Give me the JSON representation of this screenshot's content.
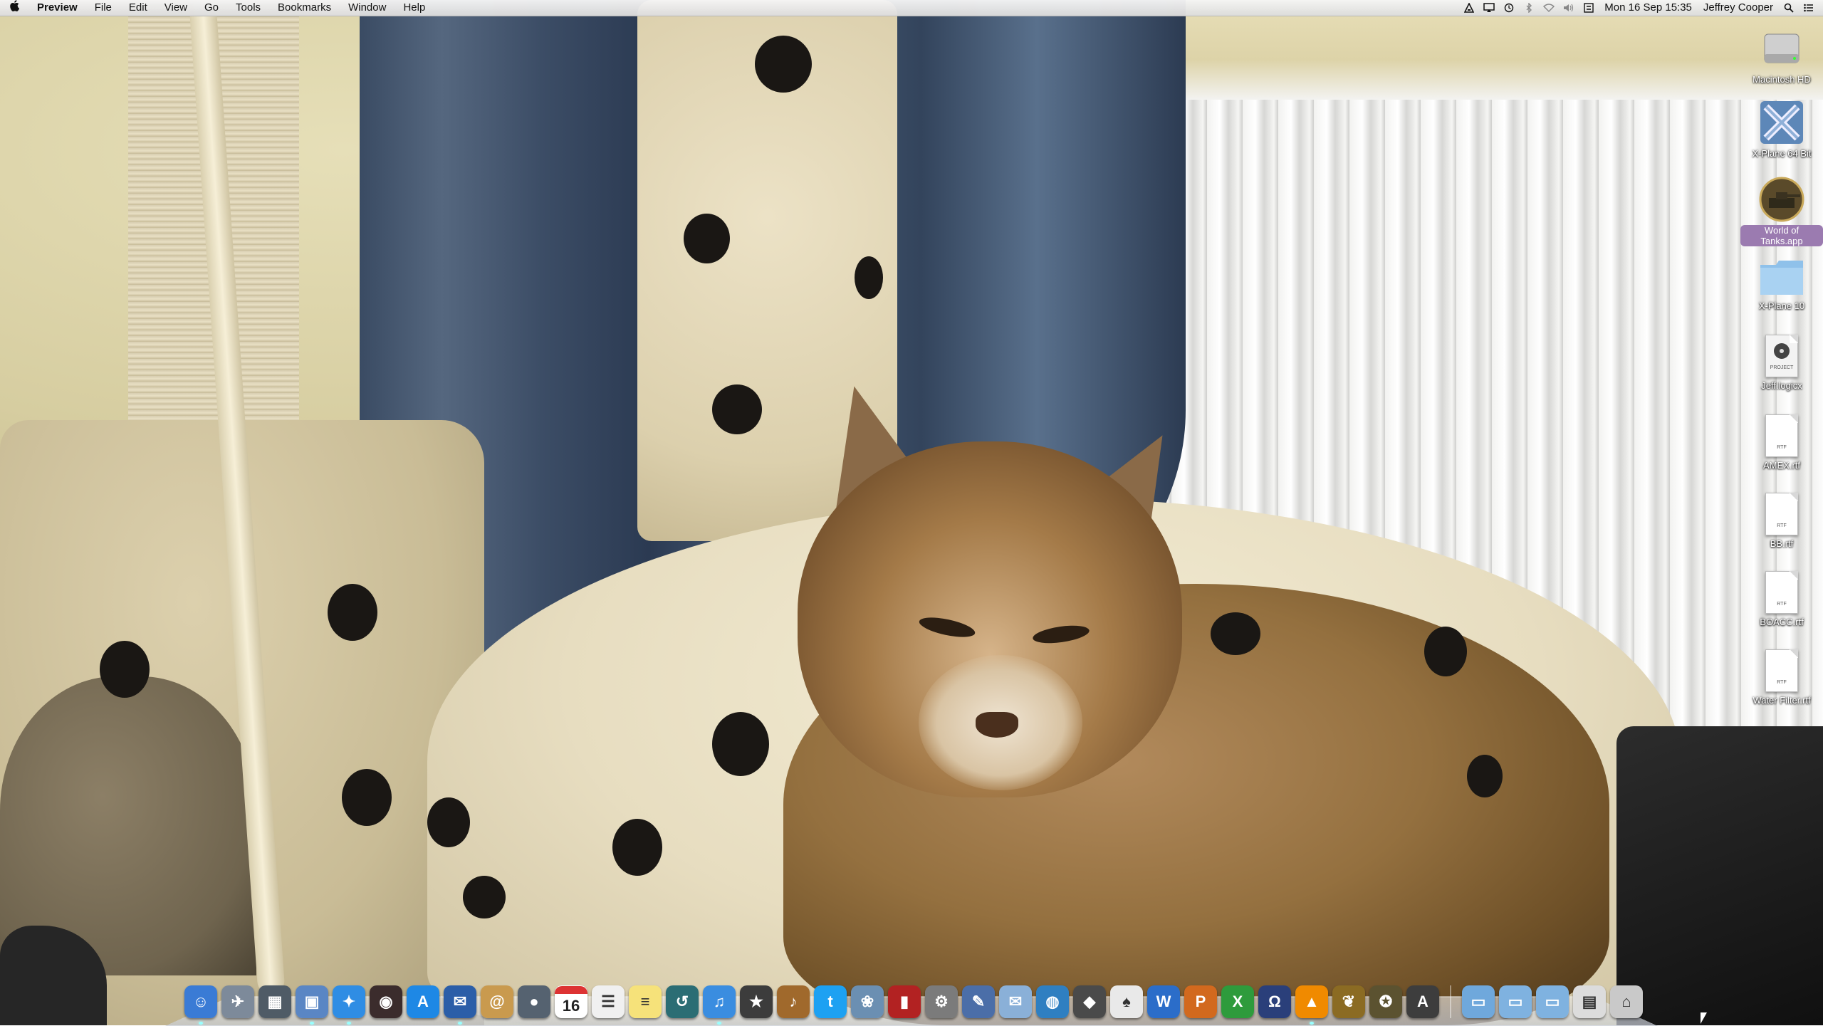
{
  "menubar": {
    "app_name": "Preview",
    "menus": [
      "File",
      "Edit",
      "View",
      "Go",
      "Tools",
      "Bookmarks",
      "Window",
      "Help"
    ],
    "status_icons": [
      "accessibility-icon",
      "airplay-icon",
      "time-machine-icon",
      "bluetooth-icon",
      "wifi-icon",
      "volume-icon",
      "input-source-icon"
    ],
    "clock": "Mon 16 Sep  15:35",
    "user": "Jeffrey Cooper"
  },
  "desktop": {
    "icons": [
      {
        "label": "Macintosh HD",
        "icon": "hard-drive-icon"
      },
      {
        "label": "X-Plane 64 Bit",
        "icon": "xplane-app-icon"
      },
      {
        "label": "World of Tanks.app",
        "icon": "world-of-tanks-icon",
        "selected": true
      },
      {
        "label": "X-Plane 10",
        "icon": "folder-icon"
      },
      {
        "label": "Jeff.logicx",
        "icon": "logic-project-icon",
        "badge": "PROJECT"
      },
      {
        "label": "AMEX.rtf",
        "icon": "rtf-document-icon",
        "badge": "RTF"
      },
      {
        "label": "BB.rtf",
        "icon": "rtf-document-icon",
        "badge": "RTF"
      },
      {
        "label": "BOACC.rtf",
        "icon": "rtf-document-icon",
        "badge": "RTF"
      },
      {
        "label": "Water Filter.rtf",
        "icon": "rtf-document-icon",
        "badge": "RTF"
      }
    ]
  },
  "dock": {
    "calendar_date": "16",
    "apps": [
      {
        "name": "finder-icon",
        "color": "#3a7bd5",
        "glyph": "☺",
        "running": true
      },
      {
        "name": "launchpad-icon",
        "color": "#7d8a9a",
        "glyph": "✈",
        "running": false
      },
      {
        "name": "mission-control-icon",
        "color": "#4f5b66",
        "glyph": "▦",
        "running": false
      },
      {
        "name": "preview-icon",
        "color": "#5a86c4",
        "glyph": "▣",
        "running": true
      },
      {
        "name": "safari-icon",
        "color": "#2f8de4",
        "glyph": "✦",
        "running": true
      },
      {
        "name": "photo-booth-icon",
        "color": "#3b2c2c",
        "glyph": "◉",
        "running": false
      },
      {
        "name": "app-store-icon",
        "color": "#1e88e5",
        "glyph": "A",
        "running": false
      },
      {
        "name": "thunderbird-icon",
        "color": "#2b5ea8",
        "glyph": "✉",
        "running": true
      },
      {
        "name": "contacts-icon",
        "color": "#c99a4e",
        "glyph": "@",
        "running": false
      },
      {
        "name": "facetime-icon",
        "color": "#556270",
        "glyph": "●",
        "running": false
      },
      {
        "name": "calendar-icon",
        "color": "#ffffff",
        "glyph": "",
        "running": false
      },
      {
        "name": "reminders-icon",
        "color": "#f0f0f0",
        "glyph": "☰",
        "running": false
      },
      {
        "name": "notes-icon",
        "color": "#f6e27a",
        "glyph": "≡",
        "running": false
      },
      {
        "name": "time-machine-icon",
        "color": "#2b6d74",
        "glyph": "↺",
        "running": false
      },
      {
        "name": "itunes-icon",
        "color": "#3a8de0",
        "glyph": "♫",
        "running": true
      },
      {
        "name": "imovie-icon",
        "color": "#3c3c3c",
        "glyph": "★",
        "running": false
      },
      {
        "name": "garageband-icon",
        "color": "#a0692c",
        "glyph": "♪",
        "running": false
      },
      {
        "name": "twitter-icon",
        "color": "#1da1f2",
        "glyph": "t",
        "running": false
      },
      {
        "name": "iphoto-icon",
        "color": "#6b8fb2",
        "glyph": "❀",
        "running": false
      },
      {
        "name": "photo-booth-strip-icon",
        "color": "#b22222",
        "glyph": "▮",
        "running": false
      },
      {
        "name": "system-preferences-icon",
        "color": "#7b7b7b",
        "glyph": "⚙",
        "running": false
      },
      {
        "name": "xcode-icon",
        "color": "#4b6ea8",
        "glyph": "✎",
        "running": false
      },
      {
        "name": "mail-icon",
        "color": "#8ab0d8",
        "glyph": "✉",
        "running": false
      },
      {
        "name": "network-globe-icon",
        "color": "#2f7fc1",
        "glyph": "◍",
        "running": false
      },
      {
        "name": "game-center-icon",
        "color": "#4a4a4a",
        "glyph": "◆",
        "running": false
      },
      {
        "name": "solitaire-icon",
        "color": "#e9e9e9",
        "glyph": "♠",
        "running": false
      },
      {
        "name": "word-icon",
        "color": "#2b6dc9",
        "glyph": "W",
        "running": false
      },
      {
        "name": "powerpoint-icon",
        "color": "#d2691e",
        "glyph": "P",
        "running": false
      },
      {
        "name": "excel-icon",
        "color": "#2e9b3c",
        "glyph": "X",
        "running": false
      },
      {
        "name": "headphones-icon",
        "color": "#2a3f7a",
        "glyph": "Ω",
        "running": false
      },
      {
        "name": "vlc-icon",
        "color": "#f08a00",
        "glyph": "▲",
        "running": true
      },
      {
        "name": "pineapple-icon",
        "color": "#8b6b23",
        "glyph": "❦",
        "running": false
      },
      {
        "name": "world-of-tanks-icon",
        "color": "#5b5230",
        "glyph": "✪",
        "running": false
      },
      {
        "name": "font-book-icon",
        "color": "#3d3d3d",
        "glyph": "A",
        "running": false
      }
    ],
    "stacks": [
      {
        "name": "applications-folder-icon",
        "color": "#6fa8dc",
        "glyph": "▭"
      },
      {
        "name": "documents-folder-icon",
        "color": "#7fb2e0",
        "glyph": "▭"
      },
      {
        "name": "downloads-folder-icon",
        "color": "#7fb2e0",
        "glyph": "▭"
      },
      {
        "name": "recent-documents-stack-icon",
        "color": "#dcdcdc",
        "glyph": "▤"
      },
      {
        "name": "trash-icon",
        "color": "#c9c9c9",
        "glyph": "⌂"
      }
    ]
  }
}
